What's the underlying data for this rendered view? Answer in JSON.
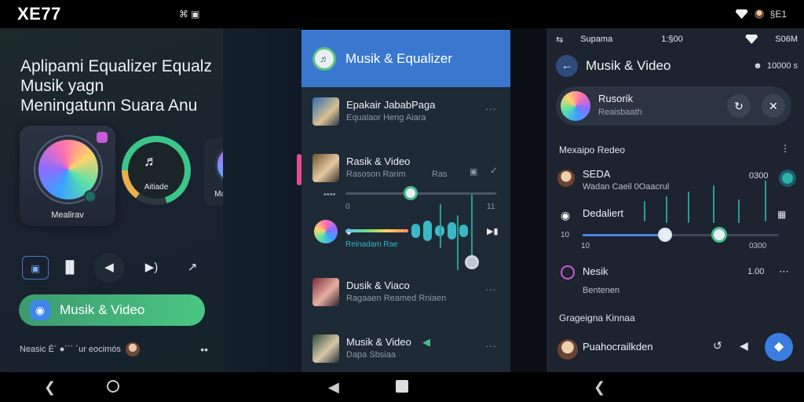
{
  "status": {
    "time": "XE77",
    "mid_icons": "⌘ ▣",
    "right_text": "§E1"
  },
  "panel1": {
    "title_lines": [
      "Aplipami Equalizer Equalz",
      "Musik yagn",
      "Meningatunn Suara Anu"
    ],
    "dial_label": "Mealirav",
    "ring_label": "Aitiade",
    "dial2_label": "Mastideane",
    "controls": [
      "▣",
      "▐▌",
      "◀",
      "▶)",
      "↗"
    ],
    "button_label": "Musik & Video",
    "footer_text": "Neasic È´ ●´´´ ´ur eocimós",
    "footer_more": "••"
  },
  "panel2": {
    "header_title": "Musik & Equalizer",
    "tracks": [
      {
        "title": "Epakair JababPaga",
        "sub": "Equalaor Heng Aiara"
      },
      {
        "title": "Rasik & Video",
        "sub": "Rasoson Rarim",
        "tag": "Ras"
      },
      {
        "title": "Dusik & Viaco",
        "sub": "Ragaaen Reamed Rniaen"
      },
      {
        "title": "Musik & Video",
        "sub": "Dapa Sbsiaa"
      }
    ],
    "slider_left": "0",
    "slider_right": "11",
    "eq_label": "Reinadam Rae"
  },
  "panel3": {
    "status_left": "Supama",
    "status_time": "1:§00",
    "status_right": "S06M",
    "title": "Musik & Video",
    "badge": "10000 s",
    "now_title": "Rusorik",
    "now_sub": "Reaisbaath",
    "section1": "Mexaipo Redeo",
    "row1_title": "SEDA",
    "row1_sub": "Wadan Caeil 0Oaacrul",
    "row1_val": "0300",
    "row2_title": "Dedaliert",
    "slider_min": "10",
    "slider_left": "10",
    "slider_right": "0300",
    "row3_title": "Nesik",
    "row3_sub": "Bentenen",
    "row3_val": "1.00",
    "section2": "Grageigna Kinnaa",
    "row4_title": "Puahocrailkden"
  }
}
